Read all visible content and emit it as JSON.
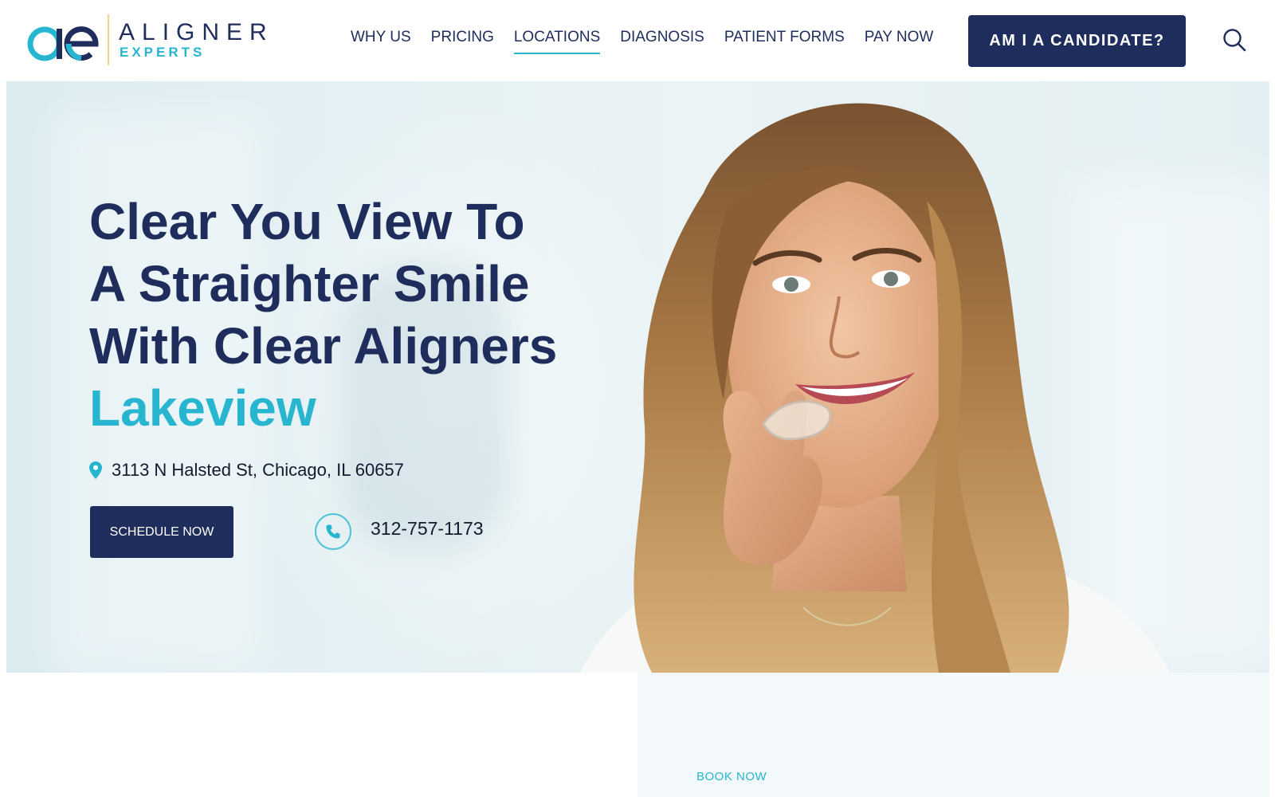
{
  "brand": {
    "name_line1": "ALIGNER",
    "name_line2": "EXPERTS",
    "primary_color": "#1f2d5c",
    "accent_color": "#27b5cf"
  },
  "nav": {
    "items": [
      {
        "label": "WHY US"
      },
      {
        "label": "PRICING"
      },
      {
        "label": "LOCATIONS",
        "active": true
      },
      {
        "label": "DIAGNOSIS"
      },
      {
        "label": "PATIENT FORMS"
      },
      {
        "label": "PAY NOW"
      }
    ],
    "cta_label": "AM I A CANDIDATE?",
    "search_icon": "search-icon"
  },
  "hero": {
    "title_lines": [
      "Clear You View To",
      "A Straighter Smile",
      "With Clear Aligners"
    ],
    "location": "Lakeview",
    "address": "3113 N Halsted St, Chicago, IL 60657",
    "address_icon": "map-pin-icon",
    "schedule_label": "SCHEDULE NOW",
    "phone_icon": "phone-icon",
    "phone": "312-757-1173",
    "image": "woman-holding-clear-aligner-photo"
  },
  "lower": {
    "book_now_label": "BOOK NOW"
  }
}
